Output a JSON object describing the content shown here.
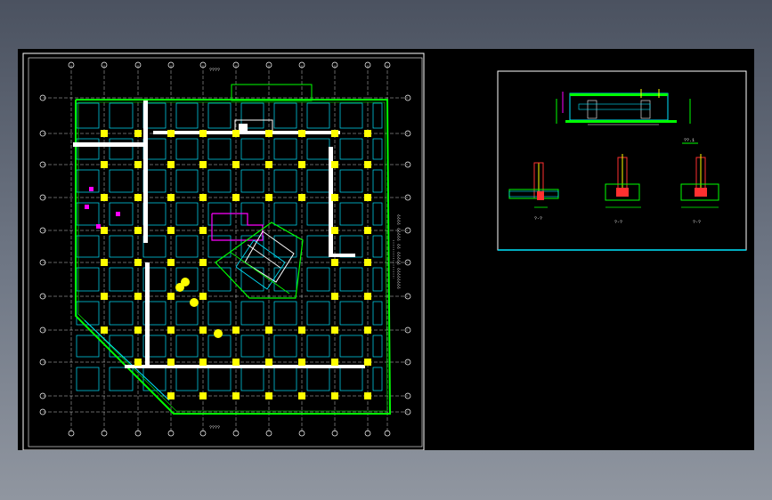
{
  "drawing": {
    "plan_vertical_note": "???????? ????? ?? ????? ????",
    "plan_top_dim": "????",
    "plan_bottom_dim": "????",
    "section_label": "??.1",
    "detail_labels": [
      "?-?",
      "?-?",
      "?-?"
    ]
  },
  "colors": {
    "background": "#000000",
    "wall": "#00ff00",
    "column": "#ffff00",
    "beam": "#00e5ff",
    "detail": "#ff00ff",
    "axis": "#ffffff"
  }
}
